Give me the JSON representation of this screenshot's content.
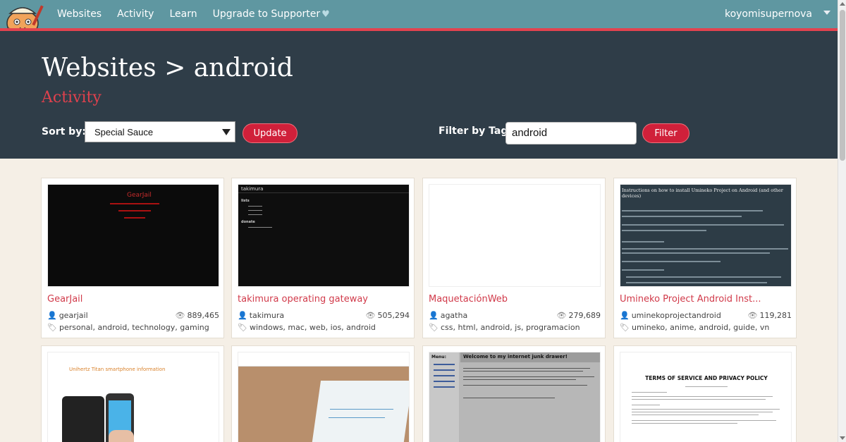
{
  "nav": {
    "links": [
      "Websites",
      "Activity",
      "Learn",
      "Upgrade to Supporter"
    ],
    "username": "koyomisupernova"
  },
  "header": {
    "breadcrumb": "Websites > android",
    "activity_link": "Activity",
    "sort_label": "Sort by:",
    "sort_value": "Special Sauce",
    "update_button": "Update",
    "filter_label": "Filter by Tag:",
    "filter_value": "android",
    "filter_button": "Filter"
  },
  "cards": [
    {
      "title": "GearJail",
      "owner": "gearjail",
      "views": "889,465",
      "tags": "personal, android, technology, gaming",
      "thumb_title": "GearJail"
    },
    {
      "title": "takimura operating gateway",
      "owner": "takimura",
      "views": "505,294",
      "tags": "windows, mac, web, ios, android",
      "thumb_title": "takimura",
      "thumb_sections": [
        "lists",
        "donate"
      ]
    },
    {
      "title": "MaquetaciónWeb",
      "owner": "agatha",
      "views": "279,689",
      "tags": "css, html, android, js, programacion"
    },
    {
      "title": "Umineko Project Android Inst...",
      "owner": "uminekoprojectandroid",
      "views": "119,281",
      "tags": "umineko, anime, android, guide, vn",
      "thumb_title": "Instructions on how to install Umineko Project on Android (and other devices)"
    },
    {
      "thumb_title": "Unihertz Titan smartphone information"
    },
    {
      "thumb_title": ""
    },
    {
      "thumb_title": "Welcome to my internet junk drawer!",
      "thumb_menu": "Menu:"
    },
    {
      "thumb_title": "TERMS OF SERVICE AND PRIVACY POLICY"
    }
  ]
}
